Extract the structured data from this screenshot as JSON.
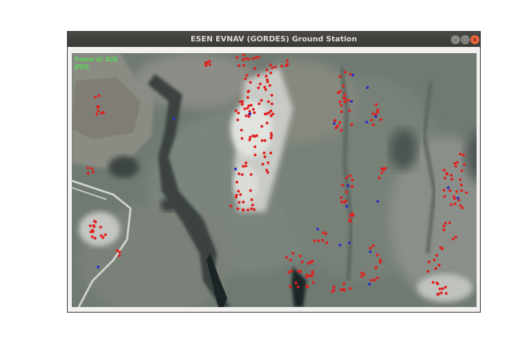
{
  "window": {
    "title": "ESEN EVNAV (GORDES) Ground Station",
    "controls": {
      "minimize": "–",
      "maximize": "□",
      "close": "×"
    }
  },
  "overlay": {
    "frame_label": "Frame Id: 828",
    "codec": "JPEG"
  },
  "markers": {
    "colors": {
      "red": "#e0201e",
      "blue": "#2b30c8"
    }
  }
}
